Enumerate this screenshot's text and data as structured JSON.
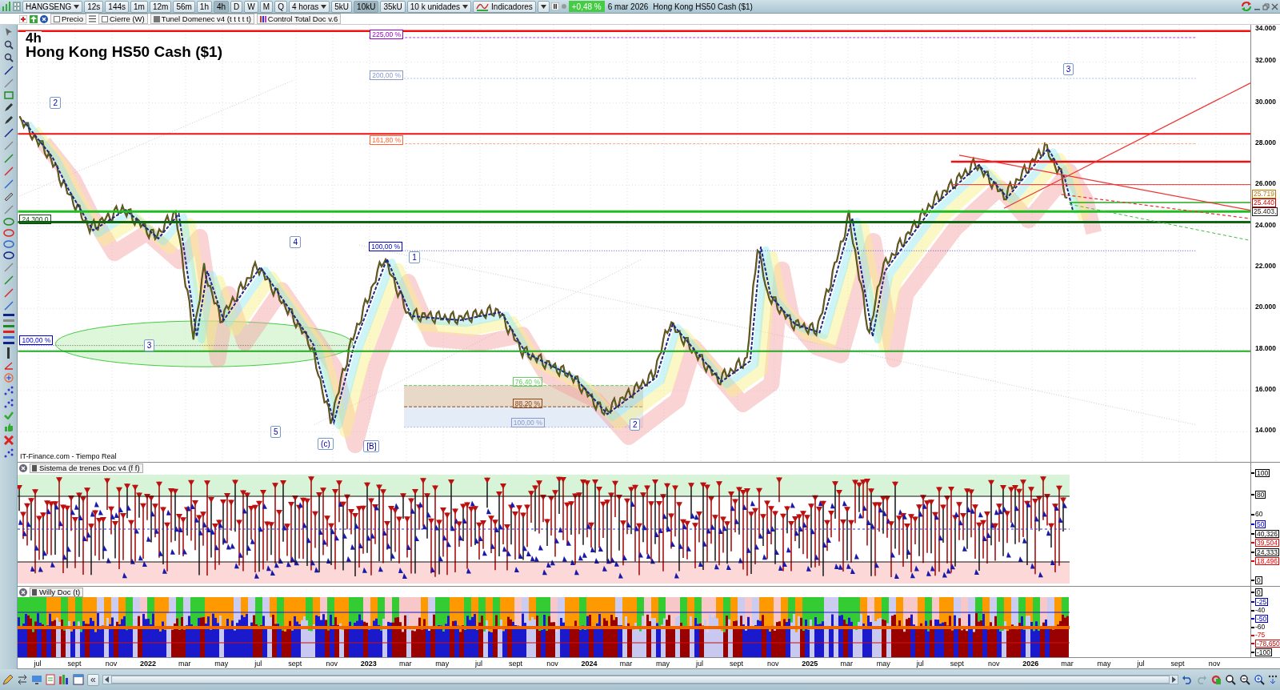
{
  "toolbar": {
    "symbol": "HANGSENG",
    "intervals": [
      {
        "label": "12s",
        "selected": false
      },
      {
        "label": "144s",
        "selected": false
      },
      {
        "label": "1m",
        "selected": false
      },
      {
        "label": "12m",
        "selected": false
      },
      {
        "label": "56m",
        "selected": false
      },
      {
        "label": "1h",
        "selected": false
      },
      {
        "label": "4h",
        "selected": true
      },
      {
        "label": "D",
        "selected": false
      },
      {
        "label": "W",
        "selected": false
      },
      {
        "label": "M",
        "selected": false
      },
      {
        "label": "Q",
        "selected": false
      }
    ],
    "period": "4 horas",
    "units": [
      {
        "label": "5kU",
        "selected": false
      },
      {
        "label": "10kU",
        "selected": true
      },
      {
        "label": "35kU",
        "selected": false
      }
    ],
    "unit_select": "10 k unidades",
    "indicators": "Indicadores",
    "change": "+0,48 %",
    "date": "6 mar 2026",
    "instrument": "Hong Kong HS50 Cash ($1)"
  },
  "legend": [
    {
      "label": "Precio",
      "kind": "checkbox"
    },
    {
      "label": "Cierre (W)",
      "kind": "checkbox"
    },
    {
      "label": "Tunel Domenec v4 (t t t t t)",
      "kind": "square"
    },
    {
      "label": "Control Total Doc v.6",
      "kind": "bars"
    }
  ],
  "chart": {
    "timeframe": "4h",
    "title": "Hong Kong HS50 Cash ($1)",
    "source": "IT-Finance.com - Tiempo Real",
    "price_ticks": [
      "34.000",
      "32.000",
      "30.000",
      "28.000",
      "26.000",
      "24.000",
      "22.000",
      "20.000",
      "18.000",
      "16.000",
      "14.000"
    ],
    "price_tags": [
      {
        "text": "25.719",
        "color": "#c07800"
      },
      {
        "text": "25.440",
        "color": "#cc0000"
      },
      {
        "text": "25.403,",
        "color": "#202020"
      }
    ],
    "fib_labels": [
      {
        "text": "225,00 %",
        "color": "#9900cc"
      },
      {
        "text": "200,00 %",
        "color": "#8899cc"
      },
      {
        "text": "161,80 %",
        "color": "#ff6633"
      },
      {
        "text": "100,00 %",
        "color": "#0000cc"
      },
      {
        "text": "100,00 %",
        "color": "#0000cc"
      },
      {
        "text": "76,40 %",
        "color": "#66cc66"
      },
      {
        "text": "88,20 %",
        "color": "#8b4513"
      },
      {
        "text": "100,00 %",
        "color": "#8899cc"
      }
    ],
    "level_label": "24.300,0",
    "wave_labels": [
      "2",
      "4",
      "3",
      "5",
      "(c)",
      "[B]",
      "1",
      "2",
      "3"
    ]
  },
  "panels": [
    {
      "title": "Sistema de trenes Doc v4 (f f)",
      "ticks": [
        {
          "text": "100",
          "kind": "boxed",
          "color": "#000000"
        },
        {
          "text": "80",
          "kind": "boxed",
          "color": "#000000"
        },
        {
          "text": "60",
          "kind": "plain",
          "color": "#000000"
        },
        {
          "text": "50",
          "kind": "boxed",
          "color": "#0000cc"
        },
        {
          "text": "40,326",
          "kind": "boxed",
          "color": "#000000"
        },
        {
          "text": "39,504",
          "kind": "boxed",
          "color": "#ee0000"
        },
        {
          "text": "24,333",
          "kind": "boxed",
          "color": "#000000"
        },
        {
          "text": "18,496",
          "kind": "boxed",
          "color": "#ee0000"
        },
        {
          "text": "0",
          "kind": "boxed",
          "color": "#000000"
        }
      ]
    },
    {
      "title": "Willy Doc (t)",
      "ticks": [
        {
          "text": "0",
          "kind": "boxed",
          "color": "#000000"
        },
        {
          "text": "-25",
          "kind": "boxed",
          "color": "#0000cc"
        },
        {
          "text": "-40",
          "kind": "plain",
          "color": "#000000"
        },
        {
          "text": "-50",
          "kind": "boxed",
          "color": "#0000cc"
        },
        {
          "text": "-60",
          "kind": "plain",
          "color": "#000000"
        },
        {
          "text": "-75",
          "kind": "plain",
          "color": "#ee0000"
        },
        {
          "text": "-78,650",
          "kind": "boxed",
          "color": "#cc0000"
        },
        {
          "text": "-100",
          "kind": "boxed",
          "color": "#000000"
        }
      ]
    }
  ],
  "time_axis": [
    {
      "text": "jul",
      "kind": "month"
    },
    {
      "text": "sept",
      "kind": "month"
    },
    {
      "text": "nov",
      "kind": "month"
    },
    {
      "text": "2022",
      "kind": "year"
    },
    {
      "text": "mar",
      "kind": "month"
    },
    {
      "text": "may",
      "kind": "month"
    },
    {
      "text": "jul",
      "kind": "month"
    },
    {
      "text": "sept",
      "kind": "month"
    },
    {
      "text": "nov",
      "kind": "month"
    },
    {
      "text": "2023",
      "kind": "year"
    },
    {
      "text": "mar",
      "kind": "month"
    },
    {
      "text": "may",
      "kind": "month"
    },
    {
      "text": "jul",
      "kind": "month"
    },
    {
      "text": "sept",
      "kind": "month"
    },
    {
      "text": "nov",
      "kind": "month"
    },
    {
      "text": "2024",
      "kind": "year"
    },
    {
      "text": "mar",
      "kind": "month"
    },
    {
      "text": "may",
      "kind": "month"
    },
    {
      "text": "jul",
      "kind": "month"
    },
    {
      "text": "sept",
      "kind": "month"
    },
    {
      "text": "nov",
      "kind": "month"
    },
    {
      "text": "2025",
      "kind": "year"
    },
    {
      "text": "mar",
      "kind": "month"
    },
    {
      "text": "may",
      "kind": "month"
    },
    {
      "text": "jul",
      "kind": "month"
    },
    {
      "text": "sept",
      "kind": "month"
    },
    {
      "text": "nov",
      "kind": "month"
    },
    {
      "text": "2026",
      "kind": "year"
    },
    {
      "text": "mar",
      "kind": "month"
    },
    {
      "text": "may",
      "kind": "month"
    },
    {
      "text": "jul",
      "kind": "month"
    },
    {
      "text": "sept",
      "kind": "month"
    },
    {
      "text": "nov",
      "kind": "month"
    }
  ],
  "bottom_bar": {
    "scroll_left": "«"
  }
}
